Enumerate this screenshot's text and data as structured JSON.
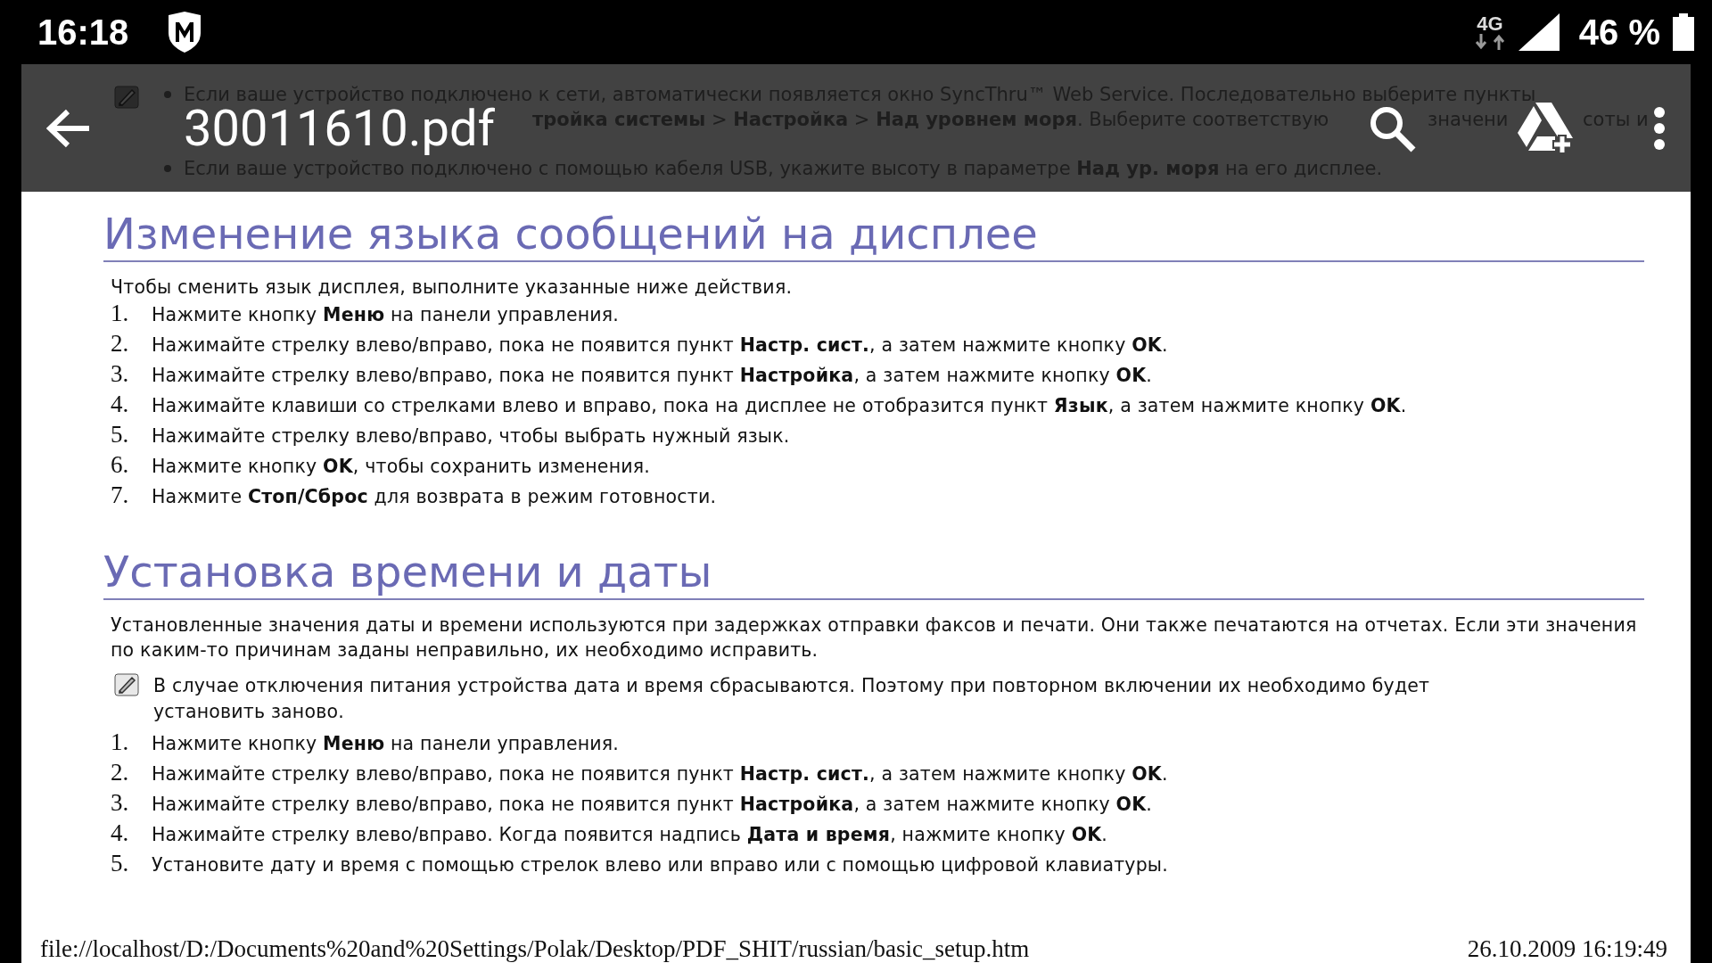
{
  "status_bar": {
    "time": "16:18",
    "network": "4G",
    "battery": "46 %"
  },
  "toolbar": {
    "title": "30011610.pdf"
  },
  "covered_text": {
    "bullets": [
      "Если ваше устройство подключено к сети, автоматически появляется окно SyncThru™ Web Service. Последовательно выберите пункты",
      "Если ваше устройство подключено с помощью кабеля USB, укажите высоту в параметре **Над ур. моря** на его дисплее."
    ],
    "line_parts": [
      "**тройка системы** > **Настройка** > **Над уровнем моря**. Выберите соответствую",
      "значени",
      "соты и"
    ]
  },
  "sections": [
    {
      "heading": "Изменение языка сообщений на дисплее",
      "intro": "Чтобы сменить язык дисплея, выполните указанные ниже действия.",
      "steps": [
        {
          "number": "1.",
          "text": "Нажмите кнопку **Меню** на панели управления."
        },
        {
          "number": "2.",
          "text": "Нажимайте стрелку влево/вправо, пока не появится пункт **Настр. сист.**, а затем нажмите кнопку **OK**."
        },
        {
          "number": "3.",
          "text": "Нажимайте стрелку влево/вправо, пока не появится пункт **Настройка**, а затем нажмите кнопку **OK**."
        },
        {
          "number": "4.",
          "text": "Нажимайте клавиши со стрелками влево и вправо, пока на дисплее не отобразится пункт **Язык**, а затем нажмите кнопку **OK**."
        },
        {
          "number": "5.",
          "text": "Нажимайте стрелку влево/вправо, чтобы выбрать нужный язык."
        },
        {
          "number": "6.",
          "text": "Нажмите кнопку **OK**, чтобы сохранить изменения."
        },
        {
          "number": "7.",
          "text": "Нажмите **Стоп/Сброс** для возврата в режим готовности."
        }
      ]
    },
    {
      "heading": "Установка времени и даты",
      "intro": "Установленные значения даты и времени используются при задержках отправки факсов и печати. Они также печатаются на отчетах. Если эти значения по каким-то причинам заданы неправильно, их необходимо исправить.",
      "note": "В случае отключения питания устройства дата и время сбрасываются. Поэтому при повторном включении их необходимо будет установить заново.",
      "steps": [
        {
          "number": "1.",
          "text": "Нажмите кнопку **Меню** на панели управления."
        },
        {
          "number": "2.",
          "text": "Нажимайте стрелку влево/вправо, пока не появится пункт **Настр. сист.**, а затем нажмите кнопку **OK**."
        },
        {
          "number": "3.",
          "text": "Нажимайте стрелку влево/вправо, пока не появится пункт **Настройка**, а затем нажмите кнопку **OK**."
        },
        {
          "number": "4.",
          "text": "Нажимайте стрелку влево/вправо. Когда появится надпись **Дата и время**, нажмите кнопку **OK**."
        },
        {
          "number": "5.",
          "text": "Установите дату и время с помощью стрелок влево или вправо или с помощью цифровой клавиатуры."
        }
      ]
    }
  ],
  "footer": {
    "path": "file://localhost/D:/Documents%20and%20Settings/Polak/Desktop/PDF_SHIT/russian/basic_setup.htm",
    "date": "26.10.2009 16:19:49"
  }
}
